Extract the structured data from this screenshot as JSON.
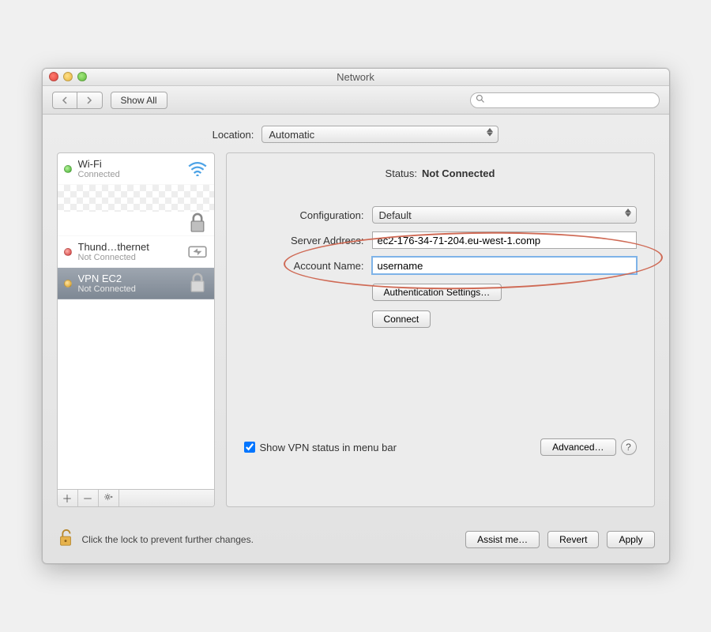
{
  "window": {
    "title": "Network"
  },
  "toolbar": {
    "show_all": "Show All",
    "search_placeholder": ""
  },
  "location": {
    "label": "Location:",
    "value": "Automatic"
  },
  "sidebar": {
    "items": [
      {
        "name": "Wi-Fi",
        "status": "Connected",
        "dot": "green",
        "icon": "wifi"
      },
      {
        "name": "Thund…thernet",
        "status": "Not Connected",
        "dot": "red",
        "icon": "thunderbolt"
      },
      {
        "name": "VPN EC2",
        "status": "Not Connected",
        "dot": "amber",
        "icon": "lock"
      }
    ]
  },
  "main": {
    "status_label": "Status:",
    "status_value": "Not Connected",
    "config_label": "Configuration:",
    "config_value": "Default",
    "server_label": "Server Address:",
    "server_value": "ec2-176-34-71-204.eu-west-1.comp",
    "account_label": "Account Name:",
    "account_value": "username",
    "auth_settings": "Authentication Settings…",
    "connect": "Connect",
    "show_vpn_checkbox": "Show VPN status in menu bar",
    "advanced": "Advanced…"
  },
  "footer": {
    "lock_msg": "Click the lock to prevent further changes.",
    "assist": "Assist me…",
    "revert": "Revert",
    "apply": "Apply"
  }
}
